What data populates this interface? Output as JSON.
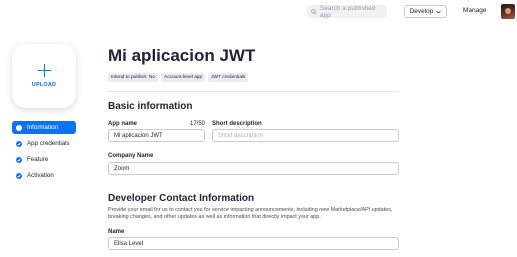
{
  "topbar": {
    "search_placeholder": "Search a published app",
    "develop_label": "Develop",
    "manage_label": "Manage"
  },
  "upload": {
    "label": "UPLOAD"
  },
  "sidebar": {
    "items": [
      {
        "label": "Information",
        "active": true
      },
      {
        "label": "App credentials",
        "active": false
      },
      {
        "label": "Feature",
        "active": false
      },
      {
        "label": "Activation",
        "active": false
      }
    ]
  },
  "app": {
    "title": "Mi aplicacion JWT",
    "tags": [
      "Intend to publish: No",
      "Account-level app",
      "JWT credentials"
    ]
  },
  "basic_info": {
    "heading": "Basic information",
    "app_name_label": "App name",
    "app_name_counter": "17/50",
    "app_name_value": "Mi aplicacion JWT",
    "short_desc_label": "Short description",
    "short_desc_placeholder": "Short description",
    "company_label": "Company Name",
    "company_value": "Zoom"
  },
  "developer_contact": {
    "heading": "Developer Contact Information",
    "description": "Provide your email for us to contact you for service impacting announcements, including new Marketplace/API updates, breaking changes, and other updates as well as information that directly impact your app.",
    "name_label": "Name",
    "name_value": "Elisa Levet"
  },
  "colors": {
    "accent": "#0e72ed",
    "text": "#232333"
  },
  "icons": {
    "search": "search-icon",
    "chevron": "chevron-down-icon",
    "check": "check-icon",
    "plus": "plus-icon"
  }
}
